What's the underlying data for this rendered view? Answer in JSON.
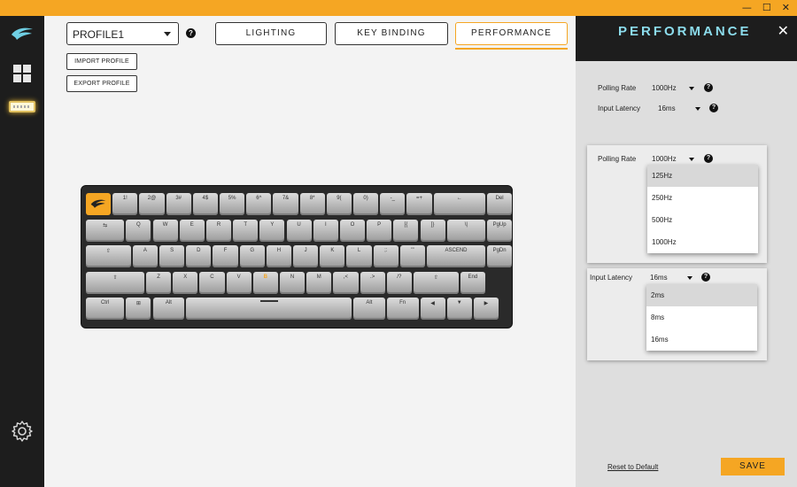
{
  "window": {
    "controls": [
      "—",
      "☐",
      "✕"
    ]
  },
  "sidebar": {
    "items": [
      {
        "name": "logo"
      },
      {
        "name": "dashboard"
      },
      {
        "name": "keyboard"
      },
      {
        "name": "settings"
      }
    ]
  },
  "toolbar": {
    "profile": "PROFILE1",
    "help_glyph": "?",
    "tabs": [
      "LIGHTING",
      "KEY BINDING",
      "PERFORMANCE"
    ],
    "active_tab": "PERFORMANCE",
    "import_label": "IMPORT PROFILE",
    "export_label": "EXPORT PROFILE"
  },
  "keyboard": {
    "rows": [
      [
        "",
        "1!",
        "2@",
        "3#",
        "4$",
        "5%",
        "6^",
        "7&",
        "8*",
        "9(",
        "0)",
        "-_",
        "=+",
        "←",
        "Del"
      ],
      [
        "⇆",
        "Q",
        "W",
        "E",
        "R",
        "T",
        "Y",
        "U",
        "I",
        "O",
        "P",
        "[{",
        "]}",
        "\\|",
        "PgUp"
      ],
      [
        "⇧",
        "A",
        "S",
        "D",
        "F",
        "G",
        "H",
        "J",
        "K",
        "L",
        ";:",
        "'\"",
        "ASCEND",
        "PgDn"
      ],
      [
        "⇧",
        "Z",
        "X",
        "C",
        "V",
        "B",
        "N",
        "M",
        ",<",
        ".>",
        "/?",
        "⇧",
        "End"
      ],
      [
        "Ctrl",
        "⊞",
        "Alt",
        "",
        "Alt",
        "Fn",
        "◀",
        "▼",
        "▶"
      ]
    ],
    "highlight_key": "B"
  },
  "panel": {
    "title": "PERFORMANCE",
    "close": "✕",
    "polling_rate": {
      "label": "Polling Rate",
      "value": "1000Hz"
    },
    "input_latency": {
      "label": "Input Latency",
      "value": "16ms"
    },
    "polling_popup": {
      "label": "Polling Rate",
      "value": "1000Hz",
      "options": [
        "125Hz",
        "250Hz",
        "500Hz",
        "1000Hz"
      ],
      "highlighted": "125Hz"
    },
    "latency_popup": {
      "label": "Input Latency",
      "value": "16ms",
      "options": [
        "2ms",
        "8ms",
        "16ms"
      ],
      "highlighted": "2ms"
    },
    "reset_label": "Reset to Default",
    "save_label": "SAVE"
  },
  "colors": {
    "accent": "#f5a623",
    "sidebar": "#1d1d1d",
    "panel_title": "#8cdcec"
  }
}
